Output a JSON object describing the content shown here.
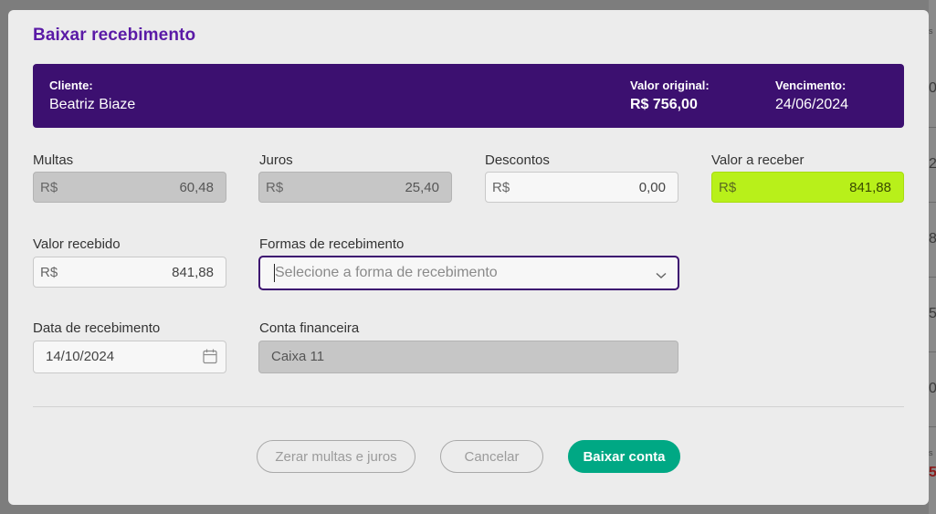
{
  "background": {
    "edge_digits": [
      "0",
      "2",
      "8",
      "5",
      "0",
      "5"
    ],
    "edge_letters": [
      "s",
      "s"
    ]
  },
  "modal": {
    "title": "Baixar recebimento"
  },
  "summary": {
    "client_label": "Cliente:",
    "client_name": "Beatriz Biaze",
    "original_value_label": "Valor original:",
    "original_value": "R$ 756,00",
    "due_label": "Vencimento:",
    "due_date": "24/06/2024",
    "banner_color": "#3c1070"
  },
  "fields": {
    "fines": {
      "label": "Multas",
      "currency": "R$",
      "value": "60,48"
    },
    "interest": {
      "label": "Juros",
      "currency": "R$",
      "value": "25,40"
    },
    "discounts": {
      "label": "Descontos",
      "currency": "R$",
      "value": "0,00"
    },
    "amount_due": {
      "label": "Valor a receber",
      "currency": "R$",
      "value": "841,88",
      "color": "#b8f01a"
    },
    "amount_received": {
      "label": "Valor recebido",
      "currency": "R$",
      "value": "841,88"
    },
    "payment_method": {
      "label": "Formas de recebimento",
      "placeholder": "Selecione a forma de recebimento"
    },
    "receipt_date": {
      "label": "Data de recebimento",
      "value": "14/10/2024"
    },
    "account": {
      "label": "Conta financeira",
      "value": "Caixa 11"
    }
  },
  "buttons": {
    "reset": "Zerar multas e juros",
    "cancel": "Cancelar",
    "submit": "Baixar conta",
    "submit_color": "#00a884"
  }
}
